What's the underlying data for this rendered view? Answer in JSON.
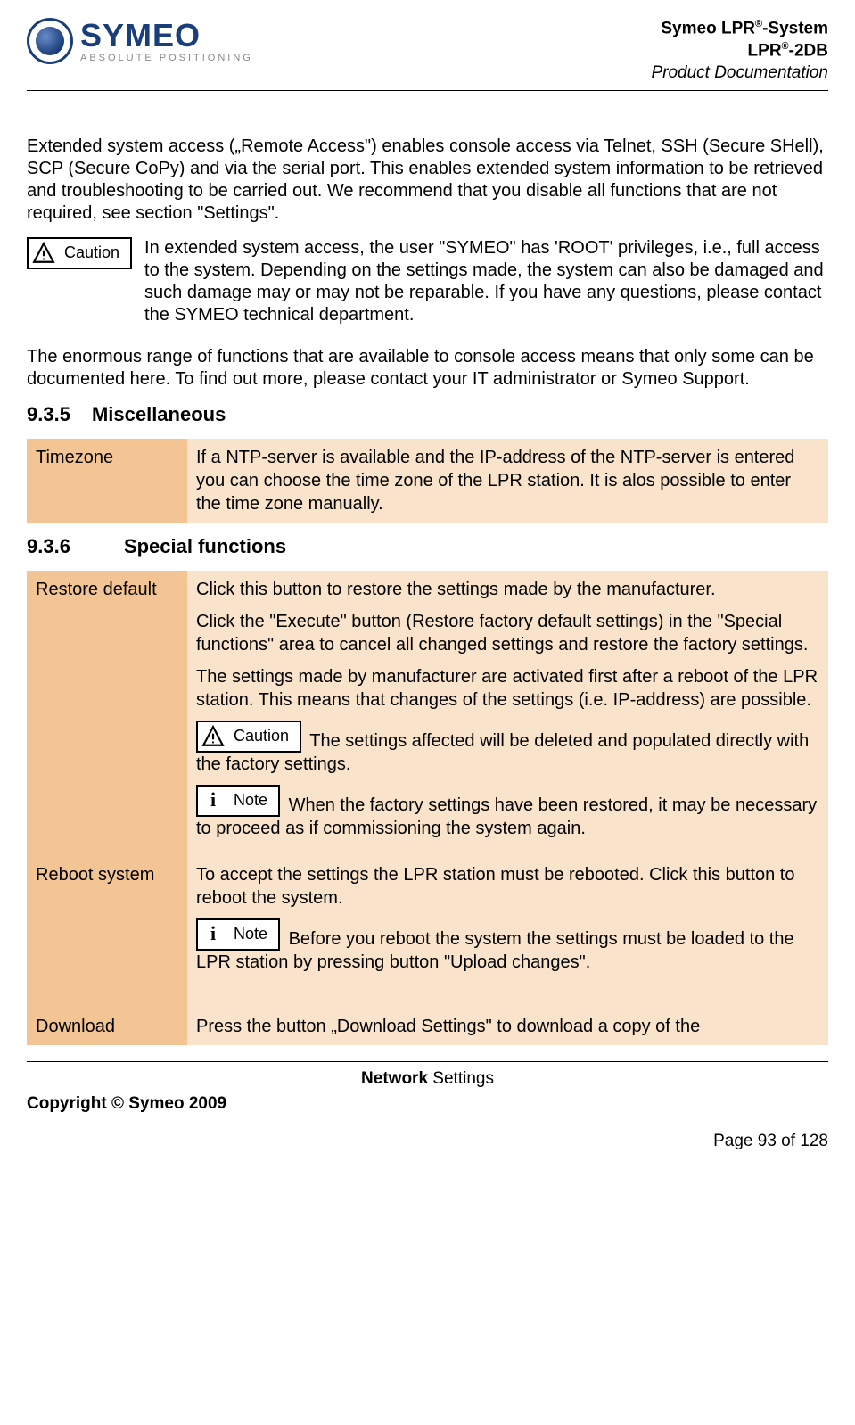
{
  "header": {
    "logo_name": "SYMEO",
    "logo_tagline": "ABSOLUTE POSITIONING",
    "title_line1_prefix": "Symeo LPR",
    "title_line1_sup": "®",
    "title_line1_suffix": "-System",
    "title_line2_prefix": "LPR",
    "title_line2_sup": "®",
    "title_line2_suffix": "-2DB",
    "subtitle": "Product Documentation"
  },
  "intro": {
    "para1": "Extended system access („Remote Access\") enables console access via Telnet, SSH (Secure SHell), SCP (Secure CoPy) and via the serial port. This enables extended system information to be retrieved and troubleshooting to be carried out. We recommend that you disable all functions that are not required, see section \"Settings\".",
    "caution_label": "Caution",
    "caution_text": "In extended system access, the user \"SYMEO\" has 'ROOT' privileges, i.e., full access to the system. Depending on the settings made, the system can also be damaged and such damage may or may not be reparable. If you have any questions, please contact the SYMEO technical department.",
    "para2": "The enormous range of functions that are available to console access means that only some can be documented here. To find out more, please contact your IT administrator or Symeo Support."
  },
  "sections": {
    "s935_number": "9.3.5",
    "s935_title": "Miscellaneous",
    "s936_number": "9.3.6",
    "s936_title": "Special functions"
  },
  "table_misc": {
    "row1_label": "Timezone",
    "row1_text": "If a NTP-server is available and the IP-address of the NTP-server is entered you can choose the time zone of the LPR station. It is alos possible to enter the time zone manually."
  },
  "table_special": {
    "row1_label": "Restore default",
    "row1_p1": "Click this button to restore the settings made by the manufacturer.",
    "row1_p2": "Click the \"Execute\" button (Restore factory default settings) in the \"Special functions\" area to cancel all changed settings and restore the factory settings.",
    "row1_p3": "The settings made by manufacturer are activated first after a reboot of the LPR station. This means that changes of the settings (i.e. IP-address) are possible.",
    "row1_caution_label": "Caution",
    "row1_caution_text": " The settings affected will be deleted and populated directly with the factory settings.",
    "row1_note_label": "Note",
    "row1_note_text": " When the factory settings have been restored, it may be necessary to proceed as if commissioning the system again.",
    "row2_label": "Reboot system",
    "row2_p1": "To accept the settings the LPR station must be rebooted. Click this button to reboot the system.",
    "row2_note_label": "Note",
    "row2_note_text": " Before you reboot the system the settings must be loaded to the LPR station by pressing button \"Upload changes\".",
    "row3_label": "Download",
    "row3_text": "Press the button „Download Settings\" to download a copy of the"
  },
  "footer": {
    "center_bold": "Network",
    "center_rest": " Settings",
    "copyright": "Copyright © Symeo 2009",
    "page": "Page 93 of 128"
  }
}
